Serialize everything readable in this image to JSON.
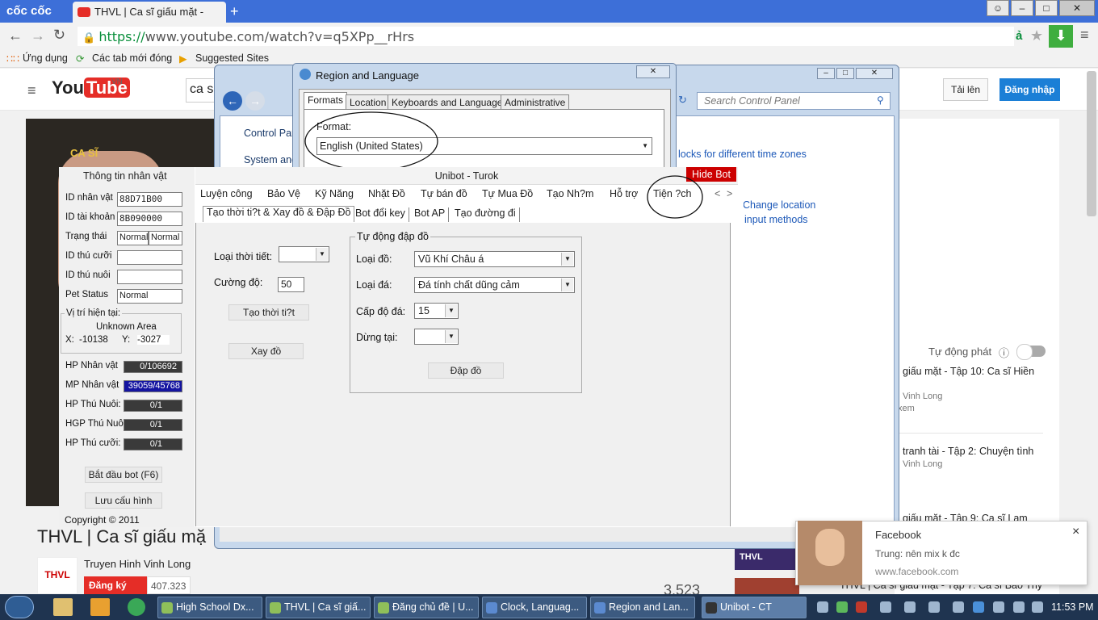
{
  "browser": {
    "brand": "cốc cốc",
    "tab_title": "THVL | Ca sĩ giấu mặt -",
    "new_tab": "+",
    "url_scheme": "https://",
    "url_rest": "www.youtube.com/watch?v=q5XPp__rHrs",
    "bookmarks": [
      "Ứng dụng",
      "Các tab mới đóng",
      "Suggested Sites"
    ]
  },
  "youtube": {
    "logo_you": "You",
    "logo_tube": "Tube",
    "logo_region": "VN",
    "search_value": "ca s",
    "upload": "Tải lên",
    "login": "Đăng nhập",
    "video_title": "THVL | Ca sĩ giấu mặ",
    "channel": "Truyen Hinh Vinh Long",
    "subscribe": "Đăng ký",
    "subscribers": "407.323",
    "views": "3.523",
    "autoplay": "Tự động phát",
    "related": [
      {
        "title": "giấu mặt - Tập 10: Ca sĩ Hiền",
        "channel": "Vinh Long",
        "meta": "xem"
      },
      {
        "title": "tranh tài - Tập 2: Chuyện tình",
        "channel": "Vinh Long",
        "meta": ""
      },
      {
        "title": "giấu mặt - Tập 9: Ca sĩ Lam",
        "channel": "",
        "meta": ""
      },
      {
        "title": "THVL | Ca sĩ giấu mặt - Tập 7: Ca sĩ Bảo Thy",
        "channel": "",
        "meta": ""
      }
    ],
    "thumb_badge": "THVL"
  },
  "control_panel": {
    "search_placeholder": "Search Control Panel",
    "left_links": [
      "Control Pan",
      "System and"
    ],
    "links": [
      "locks for different time zones",
      "Change location",
      "input methods"
    ]
  },
  "region_dialog": {
    "title": "Region and Language",
    "tabs": [
      "Formats",
      "Location",
      "Keyboards and Languages",
      "Administrative"
    ],
    "format_label": "Format:",
    "format_value": "English (United States)"
  },
  "unibot": {
    "title": "Unibot - Turok",
    "hide_bot": "Hide Bot",
    "char_info_header": "Thông tin nhân vật",
    "fields": [
      {
        "label": "ID nhân vật",
        "value": "88D71B00"
      },
      {
        "label": "ID tài khoản",
        "value": "8B090000"
      },
      {
        "label": "Trạng thái",
        "value": "Normal",
        "value2": "Normal"
      },
      {
        "label": "ID thú cưỡi",
        "value": ""
      },
      {
        "label": "ID thú nuôi",
        "value": ""
      },
      {
        "label": "Pet Status",
        "value": "Normal"
      }
    ],
    "location_header": "Vị trí hiện tại:",
    "location_name": "Unknown Area",
    "x_label": "X:",
    "x_value": "-10138",
    "y_label": "Y:",
    "y_value": "-3027",
    "bars": [
      {
        "label": "HP Nhân vật",
        "value": "0/106692",
        "fill": 0
      },
      {
        "label": "MP Nhân vật",
        "value": "39059/45768",
        "fill": 0.85
      },
      {
        "label": "HP Thú Nuôi:",
        "value": "0/1",
        "fill": 0
      },
      {
        "label": "HGP Thú Nuôi:",
        "value": "0/1",
        "fill": 0
      },
      {
        "label": "HP Thú cưỡi:",
        "value": "0/1",
        "fill": 0
      }
    ],
    "start_button": "Bắt đầu bot (F6)",
    "save_button": "Lưu cấu hình",
    "copyright": "Copyright © 2011",
    "menu": [
      "Luyện công",
      "Bảo Vệ",
      "Kỹ Năng",
      "Nhặt Đồ",
      "Tự bán đồ",
      "Tự Mua Đồ",
      "Tạo Nh?m",
      "Hỗ trợ",
      "Tiện ?ch"
    ],
    "menu_prev": "<",
    "menu_next": ">",
    "subtabs": [
      "Tạo thời ti?t & Xay đồ & Đập Đồ",
      "Bot đổi key",
      "Bot AP",
      "Tạo đường đi"
    ],
    "weather_label": "Loại thời tiết:",
    "weather_value": "",
    "strength_label": "Cường độ:",
    "strength_value": "50",
    "make_weather_button": "Tạo thời ti?t",
    "grind_button": "Xay đồ",
    "group_title": "Tự động đập đồ",
    "item_type_label": "Loại đồ:",
    "item_type_value": "Vũ Khí Châu á",
    "stone_type_label": "Loại đá:",
    "stone_type_value": "Đá tính chất dũng cảm",
    "stone_level_label": "Cấp độ đá:",
    "stone_level_value": "15",
    "stop_at_label": "Dừng tại:",
    "stop_at_value": "",
    "smash_button": "Đập đồ"
  },
  "notification": {
    "source": "Facebook",
    "message": "Trung: nên mix k đc",
    "site": "www.facebook.com",
    "close": "×"
  },
  "taskbar": {
    "tasks": [
      "High School Dx...",
      "THVL | Ca sĩ giấ...",
      "Đăng chủ đề | U...",
      "Clock, Languag...",
      "Region and Lan...",
      "Unibot - CT"
    ],
    "clock": "11:53 PM"
  },
  "colors": {
    "chrome_blue": "#3d6fd8",
    "yt_red": "#e52d27",
    "hide_bot": "#cc0000",
    "mp_bar": "#1414a0"
  }
}
